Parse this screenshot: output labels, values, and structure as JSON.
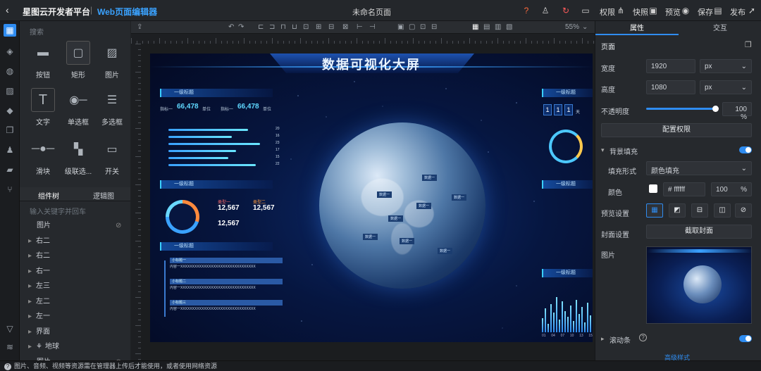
{
  "topbar": {
    "back_label": "‹",
    "brand": "星图云开发者平台",
    "separator": "|",
    "subtitle": "Web页面编辑器",
    "page_name": "未命名页面",
    "actions": [
      "权限",
      "快照",
      "预览",
      "保存",
      "发布"
    ]
  },
  "components": {
    "search_placeholder": "搜索",
    "items": [
      "按钮",
      "矩形",
      "图片",
      "文字",
      "单选框",
      "多选框",
      "滑块",
      "级联选...",
      "开关"
    ]
  },
  "layer_panel": {
    "tabs": [
      "组件树",
      "逻辑图"
    ],
    "search_placeholder": "输入关键字并回车",
    "items": [
      "图片",
      "右二",
      "右二",
      "右一",
      "左三",
      "左二",
      "左一",
      "界面",
      "地球",
      "图片"
    ]
  },
  "canvas": {
    "zoom": "55%",
    "screen_title": "数据可视化大屏",
    "panel_title": "一级标题",
    "metric_label_1": "指标一",
    "metric_value": "66,478",
    "metric_unit": "单位",
    "bar_values": [
      20,
      16,
      23,
      17,
      15,
      22
    ],
    "legend_1": "类型一",
    "legend_2": "类型二",
    "value_12567": "12,567",
    "list_title": "小标题一",
    "list_title_2": "小标题二",
    "list_title_3": "小标题三",
    "list_text": "内容一XXXXXXXXXXXXXXXXXXXXXXXXXXXXXXXX",
    "digits": [
      "1",
      "1",
      "1"
    ],
    "day_label": "天",
    "globe_tags": [
      "数据一",
      "数据一",
      "数据一",
      "数据一",
      "数据一",
      "数据一",
      "数据一",
      "数据一"
    ],
    "axis_ticks": [
      "01",
      "04",
      "07",
      "10",
      "13",
      "15"
    ]
  },
  "props": {
    "tabs": [
      "属性",
      "交互"
    ],
    "section_page": "页面",
    "width_label": "宽度",
    "width_value": "1920",
    "height_label": "高度",
    "height_value": "1080",
    "unit": "px",
    "opacity_label": "不透明度",
    "opacity_value": "100",
    "opacity_unit": "%",
    "config_btn": "配置权限",
    "bg_fill_label": "背景填充",
    "fill_mode_label": "填充形式",
    "fill_mode_value": "颜色填充",
    "color_label": "颜色",
    "color_value": "# ffffff",
    "color_opacity": "100",
    "preview_label": "预览设置",
    "cover_label": "封面设置",
    "cover_btn": "截取封面",
    "image_label": "图片",
    "scroll_label": "滚动条",
    "more_label": "高级样式"
  },
  "status": {
    "text": "图片、音频、视频等资源需在管理器上传后才能使用，或者使用网络资源"
  },
  "colors": {
    "accent": "#2f8cf0",
    "brand_sub": "#3aa2ff"
  }
}
